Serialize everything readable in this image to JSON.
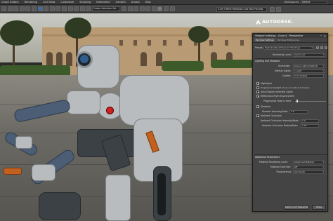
{
  "menubar": {
    "items": [
      "Graph Editors",
      "Rendering",
      "Civil View",
      "Customize",
      "Scripting",
      "Interactive",
      "Content",
      "Arnold",
      "Help"
    ],
    "workspaces_label": "Workspaces:",
    "workspaces_value": "Default"
  },
  "toolbar": {
    "view_dropdown": "Create Selection Set",
    "render_dropdown": "5.0m  Offline Reflection  3ds Max Preview"
  },
  "brand": {
    "logo_text": "AUTODESK."
  },
  "dialog": {
    "title": "Viewport settings - Quad 4 - Perspective",
    "tabs": [
      "Per-View Settings",
      "Per-View Preferences"
    ],
    "preset_label": "Preset:",
    "preset_value": "High Quality (Enhanced Shading)",
    "rendering_level_label": "Rendering Level:",
    "rendering_level_value": "Advanced",
    "lighting_section": "Lighting and Shadows",
    "illumination_label": "Illuminate:",
    "illumination_value": "Scene Lights (Default)",
    "default_lights_label": "Default Lights:",
    "default_lights_value": "1 Light",
    "quality_label": "Quality:",
    "quality_value": "2.0x Default",
    "highlights_label": "Highlights",
    "progressive_label": "Progressive Skylight (more accurate but slower)",
    "auto_display_label": "Auto Display Selected Lights",
    "reflections_label": "Reflections From Environment",
    "fade_label": "Progressive Fade-in time:",
    "shadows_label": "Shadows",
    "shadow_intensity_label": "Shadow Intensity/Fade:",
    "shadow_intensity_value": "1.0",
    "ao_label": "Ambient Occlusion",
    "ao_intensity_label": "Ambient Occlusion Intensity/Fade:",
    "ao_intensity_value": "1.0",
    "ao_radius_label": "Ambient Occlusion Radius/Fade:",
    "ao_radius_value": "1.57",
    "transparency_section": "Additional Parameters",
    "material_rendering_label": "Material Rendering Level:",
    "material_rendering_value": "Advanced Material",
    "material_override_label": "Material Override:",
    "material_override_value": "Off",
    "transparency_label": "Transparency:",
    "transparency_value": "Stochastic",
    "apply_all_label": "Apply to All Viewports",
    "close_label": "Close"
  },
  "colors": {
    "panel_bg": "#444444",
    "accent_orange": "#c2611f",
    "eye_red": "#d01f1f"
  }
}
